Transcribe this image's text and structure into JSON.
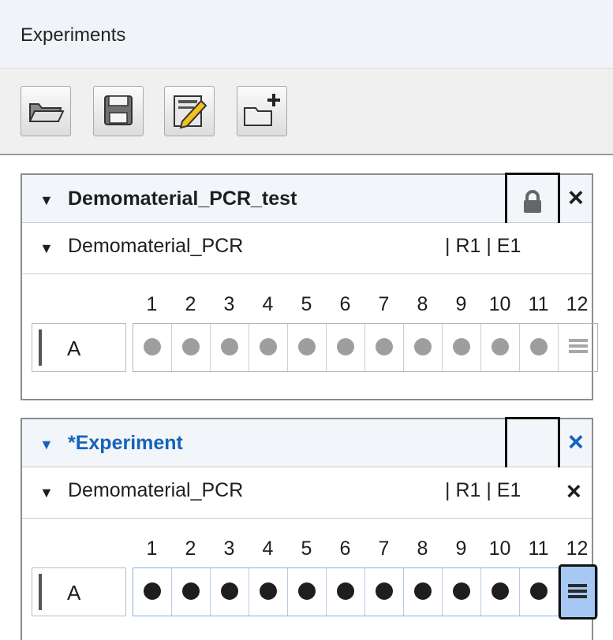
{
  "header": {
    "title": "Experiments"
  },
  "toolbar": {
    "buttons": [
      {
        "name": "open-folder-button",
        "icon": "open-folder-icon"
      },
      {
        "name": "save-button",
        "icon": "floppy-disk-icon"
      },
      {
        "name": "edit-button",
        "icon": "pencil-edit-icon"
      },
      {
        "name": "new-folder-button",
        "icon": "folder-plus-icon"
      }
    ]
  },
  "experiments": [
    {
      "name": "Demomaterial_PCR_test",
      "locked": true,
      "close": "×",
      "material": {
        "name": "Demomaterial_PCR",
        "tags": "| R1 | E1"
      },
      "row_label": "A",
      "columns": [
        "1",
        "2",
        "3",
        "4",
        "5",
        "6",
        "7",
        "8",
        "9",
        "10",
        "11",
        "12"
      ],
      "well_color": "#9e9e9e"
    },
    {
      "name": "*Experiment",
      "locked": false,
      "close": "×",
      "material": {
        "name": "Demomaterial_PCR",
        "tags": "| R1 | E1",
        "close": "×"
      },
      "row_label": "A",
      "columns": [
        "1",
        "2",
        "3",
        "4",
        "5",
        "6",
        "7",
        "8",
        "9",
        "10",
        "11",
        "12"
      ],
      "well_color": "#1e1e1e",
      "selected_column": "12"
    }
  ],
  "colors": {
    "accent": "#1563b8",
    "selection": "#a6c8f2"
  }
}
